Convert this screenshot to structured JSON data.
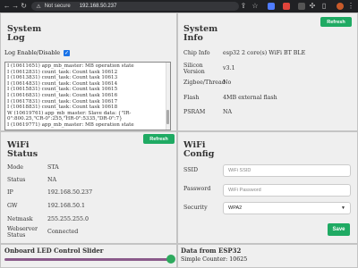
{
  "browser": {
    "back_icon": "arrow-left-icon",
    "security_label": "Not secure",
    "url": "192.168.50.237"
  },
  "system_log": {
    "title_line1": "System",
    "title_line2": "Log",
    "enable_label": "Log Enable/Disable",
    "enabled": true,
    "lines": [
      "I (10611651) app_mb_master: MB operation state",
      "I (10612831) count_task: Count task 10612",
      "I (10613831) count_task: Count task 10613",
      "I (10614831) count_task: Count task 10614",
      "I (10615831) count_task: Count task 10615",
      "I (10616831) count_task: Count task 10616",
      "I (10617831) count_task: Count task 10617",
      "I (10618831) count_task: Count task 10618",
      "W (10619761) app_mb_master: Slave data: {\"IR-",
      "0\":800.25,\"CR-0\":255,\"HR-0\":5335,\"DR-0\":7}",
      "I (10619771) app_mb_master: MB operation state"
    ]
  },
  "system_info": {
    "title_line1": "System",
    "title_line2": "Info",
    "refresh_label": "Refresh",
    "rows": [
      {
        "label": "Chip Info",
        "value": "esp32 2 core(s) WiFi BT BLE"
      },
      {
        "label": "Silicon",
        "label2": "Version",
        "value": "v3.1"
      },
      {
        "label": "Zigbee/Thread",
        "value": "No"
      },
      {
        "label": "Flash",
        "value": "4MB external flash"
      },
      {
        "label": "PSRAM",
        "value": "NA"
      }
    ]
  },
  "wifi_status": {
    "title_line1": "WiFi",
    "title_line2": "Status",
    "refresh_label": "Refresh",
    "rows": [
      {
        "label": "Mode",
        "value": "STA"
      },
      {
        "label": "Status",
        "value": "NA"
      },
      {
        "label": "IP",
        "value": "192.168.50.237"
      },
      {
        "label": "GW",
        "value": "192.168.50.1"
      },
      {
        "label": "Netmask",
        "value": "255.255.255.0"
      },
      {
        "label": "Webserver",
        "label2": "Status",
        "value": "Connected"
      }
    ]
  },
  "wifi_config": {
    "title_line1": "WiFi",
    "title_line2": "Config",
    "ssid_label": "SSID",
    "ssid_placeholder": "WiFi SSID",
    "password_label": "Password",
    "password_placeholder": "WiFi Password",
    "security_label": "Security",
    "security_value": "WPA2",
    "save_label": "Save"
  },
  "led_slider": {
    "title": "Onboard LED Control Slider",
    "value_fraction": 1.0
  },
  "esp32_data": {
    "title": "Data from ESP32",
    "counter_label": "Simple Counter:",
    "counter_value": "10625"
  },
  "colors": {
    "accent_green": "#1faa63",
    "slider_track": "#8a5a8a",
    "chrome_bg": "#202124"
  }
}
